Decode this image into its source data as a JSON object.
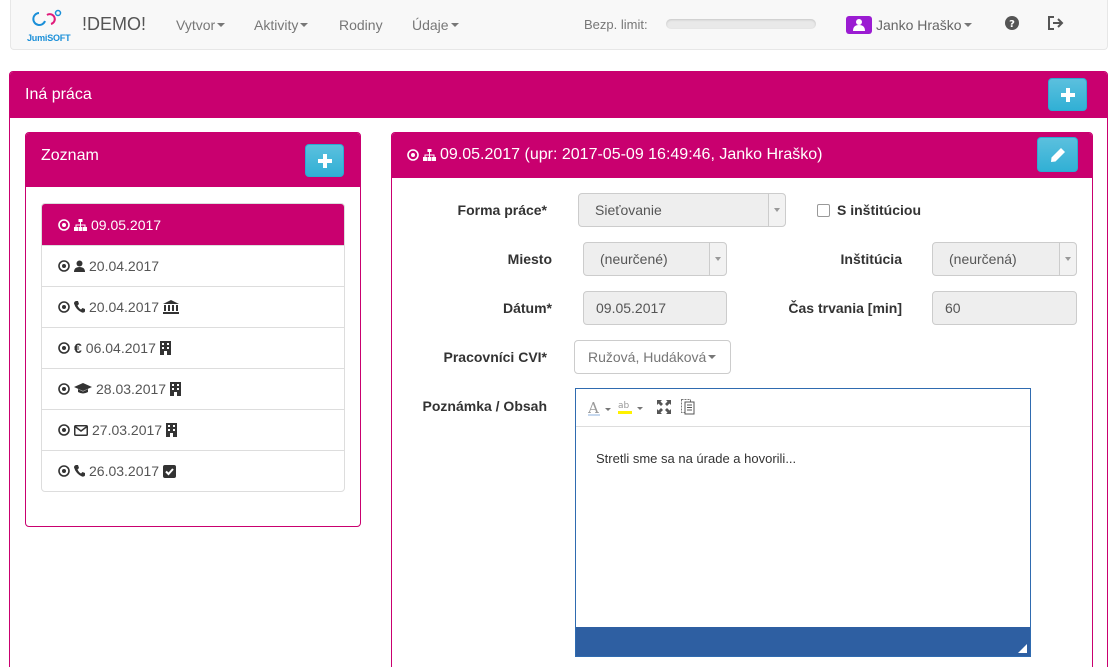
{
  "navbar": {
    "logo_text": "JumiSOFT",
    "brand": "!DEMO!",
    "menu": [
      {
        "label": "Vytvor"
      },
      {
        "label": "Aktivity"
      },
      {
        "label": "Rodiny"
      },
      {
        "label": "Údaje"
      }
    ],
    "limit_label": "Bezp. limit:",
    "limit_fraction": 0.0,
    "user_name": "Janko Hraško"
  },
  "page": {
    "title": "Iná práca"
  },
  "list": {
    "title": "Zoznam",
    "items": [
      {
        "date": "09.05.2017",
        "icon": "sitemap-icon",
        "trailing_icon": ""
      },
      {
        "date": "20.04.2017",
        "icon": "user-icon",
        "trailing_icon": ""
      },
      {
        "date": "20.04.2017",
        "icon": "phone-icon",
        "trailing_icon": "institution-icon"
      },
      {
        "date": "06.04.2017",
        "icon": "euro-icon",
        "trailing_icon": "building-icon"
      },
      {
        "date": "28.03.2017",
        "icon": "graduation-cap-icon",
        "trailing_icon": "building-icon"
      },
      {
        "date": "27.03.2017",
        "icon": "envelope-icon",
        "trailing_icon": "building-icon"
      },
      {
        "date": "26.03.2017",
        "icon": "phone-icon",
        "trailing_icon": "check-square-icon"
      }
    ]
  },
  "detail": {
    "title": "09.05.2017 (upr: 2017-05-09 16:49:46, Janko Hraško)",
    "form": {
      "forma_label": "Forma práce*",
      "forma_value": "Sieťovanie",
      "institution_checkbox_label": "S inštitúciou",
      "miesto_label": "Miesto",
      "miesto_value": "(neurčené)",
      "institucia_label": "Inštitúcia",
      "institucia_value": "(neurčená)",
      "datum_label": "Dátum*",
      "datum_value": "09.05.2017",
      "cas_label": "Čas trvania [min]",
      "cas_value": "60",
      "pracovnici_label": "Pracovníci CVI*",
      "pracovnici_value": "Ružová, Hudáková",
      "poznamka_label": "Poznámka / Obsah",
      "poznamka_text": "Stretli sme sa na úrade a hovorili..."
    }
  },
  "colors": {
    "brand": "#c9006f",
    "info_button": "#5bc0de",
    "editor_status": "#2e5fa2",
    "user_badge": "#9b1cd2"
  }
}
